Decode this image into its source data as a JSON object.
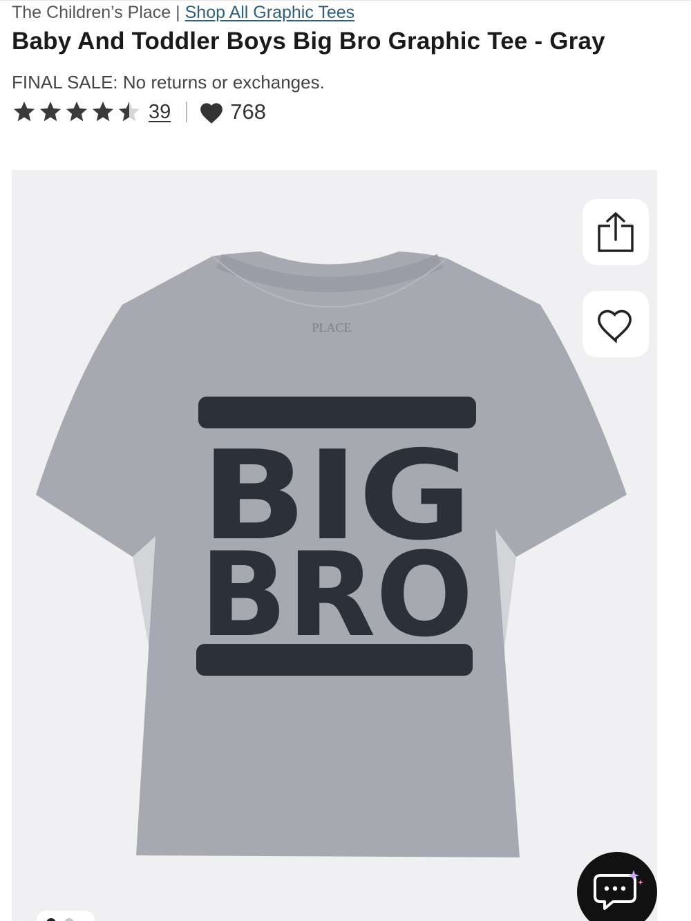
{
  "breadcrumb": {
    "brand": "The Children’s Place",
    "separator": "|",
    "link_label": "Shop All Graphic Tees"
  },
  "product": {
    "title": "Baby And Toddler Boys Big Bro Graphic Tee - Gray",
    "final_sale_notice": "FINAL SALE: No returns or exchanges.",
    "rating": 4.5,
    "rating_max": 5,
    "review_count": "39",
    "favorites_count": "768"
  },
  "gallery": {
    "shirt_color": "#a7a9b1",
    "print_color": "#2b3138",
    "shirt_print_line1": "BIG",
    "shirt_print_line2": "BRO",
    "shirt_label_text": "PLACE",
    "share_icon": "share-icon",
    "favorite_icon": "heart-outline-icon",
    "current_image": 1,
    "image_count": 2
  },
  "chat": {
    "icon": "chat-bubble-icon"
  },
  "colors": {
    "link": "#2f5f7f",
    "star_filled": "#3a3a3a",
    "star_empty": "#d6d6d6"
  }
}
